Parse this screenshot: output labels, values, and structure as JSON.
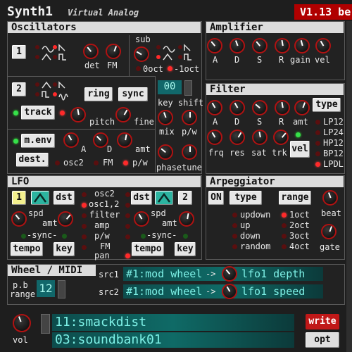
{
  "header": {
    "app_title": "Synth1",
    "subtitle": "Virtual Analog",
    "version": "V1.13 be"
  },
  "oscillators": {
    "title": "Oscillators",
    "osc1_label": "1",
    "osc2_label": "2",
    "det": "det",
    "fm": "FM",
    "sub": "sub",
    "oct0": "0oct",
    "octm1": "-1oct",
    "ring": "ring",
    "sync": "sync",
    "track": "track",
    "pitch": "pitch",
    "fine": "fine",
    "lcd_value": "00",
    "key_shift": "key shift",
    "mix": "mix",
    "pw": "p/w",
    "menv": "m.env",
    "dest": "dest.",
    "a": "A",
    "d": "D",
    "amt": "amt",
    "osc2": "osc2",
    "fm2": "FM",
    "pw2": "p/w",
    "phase": "phase",
    "tune": "tune"
  },
  "amplifier": {
    "title": "Amplifier",
    "a": "A",
    "d": "D",
    "s": "S",
    "r": "R",
    "gain": "gain",
    "vel": "vel"
  },
  "filter": {
    "title": "Filter",
    "type": "type",
    "a": "A",
    "d": "D",
    "s": "S",
    "r": "R",
    "amt": "amt",
    "frq": "frq",
    "res": "res",
    "sat": "sat",
    "trk": "trk",
    "vel": "vel",
    "types": [
      "LP12",
      "LP24",
      "HP12",
      "BP12",
      "LPDL"
    ],
    "selected_type": "LPDL"
  },
  "lfo": {
    "title": "LFO",
    "lfo1": "1",
    "lfo2": "2",
    "dst": "dst",
    "spd": "spd",
    "amt": "amt",
    "sync": "-sync-",
    "tempo": "tempo",
    "key": "key",
    "destinations": [
      "osc2",
      "osc1,2",
      "filter",
      "amp",
      "p/w",
      "FM",
      "pan"
    ]
  },
  "arpeggiator": {
    "title": "Arpeggiator",
    "on": "ON",
    "type": "type",
    "range": "range",
    "beat": "beat",
    "gate": "gate",
    "types": [
      "updown",
      "up",
      "down",
      "random"
    ],
    "ranges": [
      "1oct",
      "2oct",
      "3oct",
      "4oct"
    ]
  },
  "wheel": {
    "title": "Wheel / MIDI",
    "pb": "p.b",
    "range": "range",
    "pb_value": "12",
    "src1": "src1",
    "src2": "src2",
    "src1_value": "#1:mod wheel",
    "src2_value": "#1:mod wheel",
    "arrow": "->",
    "dst1": "lfo1 depth",
    "dst2": "lfo1 speed"
  },
  "footer": {
    "vol": "vol",
    "patch": "11:smackdist",
    "bank": "03:soundbank01",
    "write": "write",
    "opt": "opt"
  },
  "colors": {
    "accent_red": "#ff2a2a",
    "lcd_teal": "#0f6a66",
    "title_bg": "#dcdcdc",
    "version_bg": "#b00000"
  }
}
